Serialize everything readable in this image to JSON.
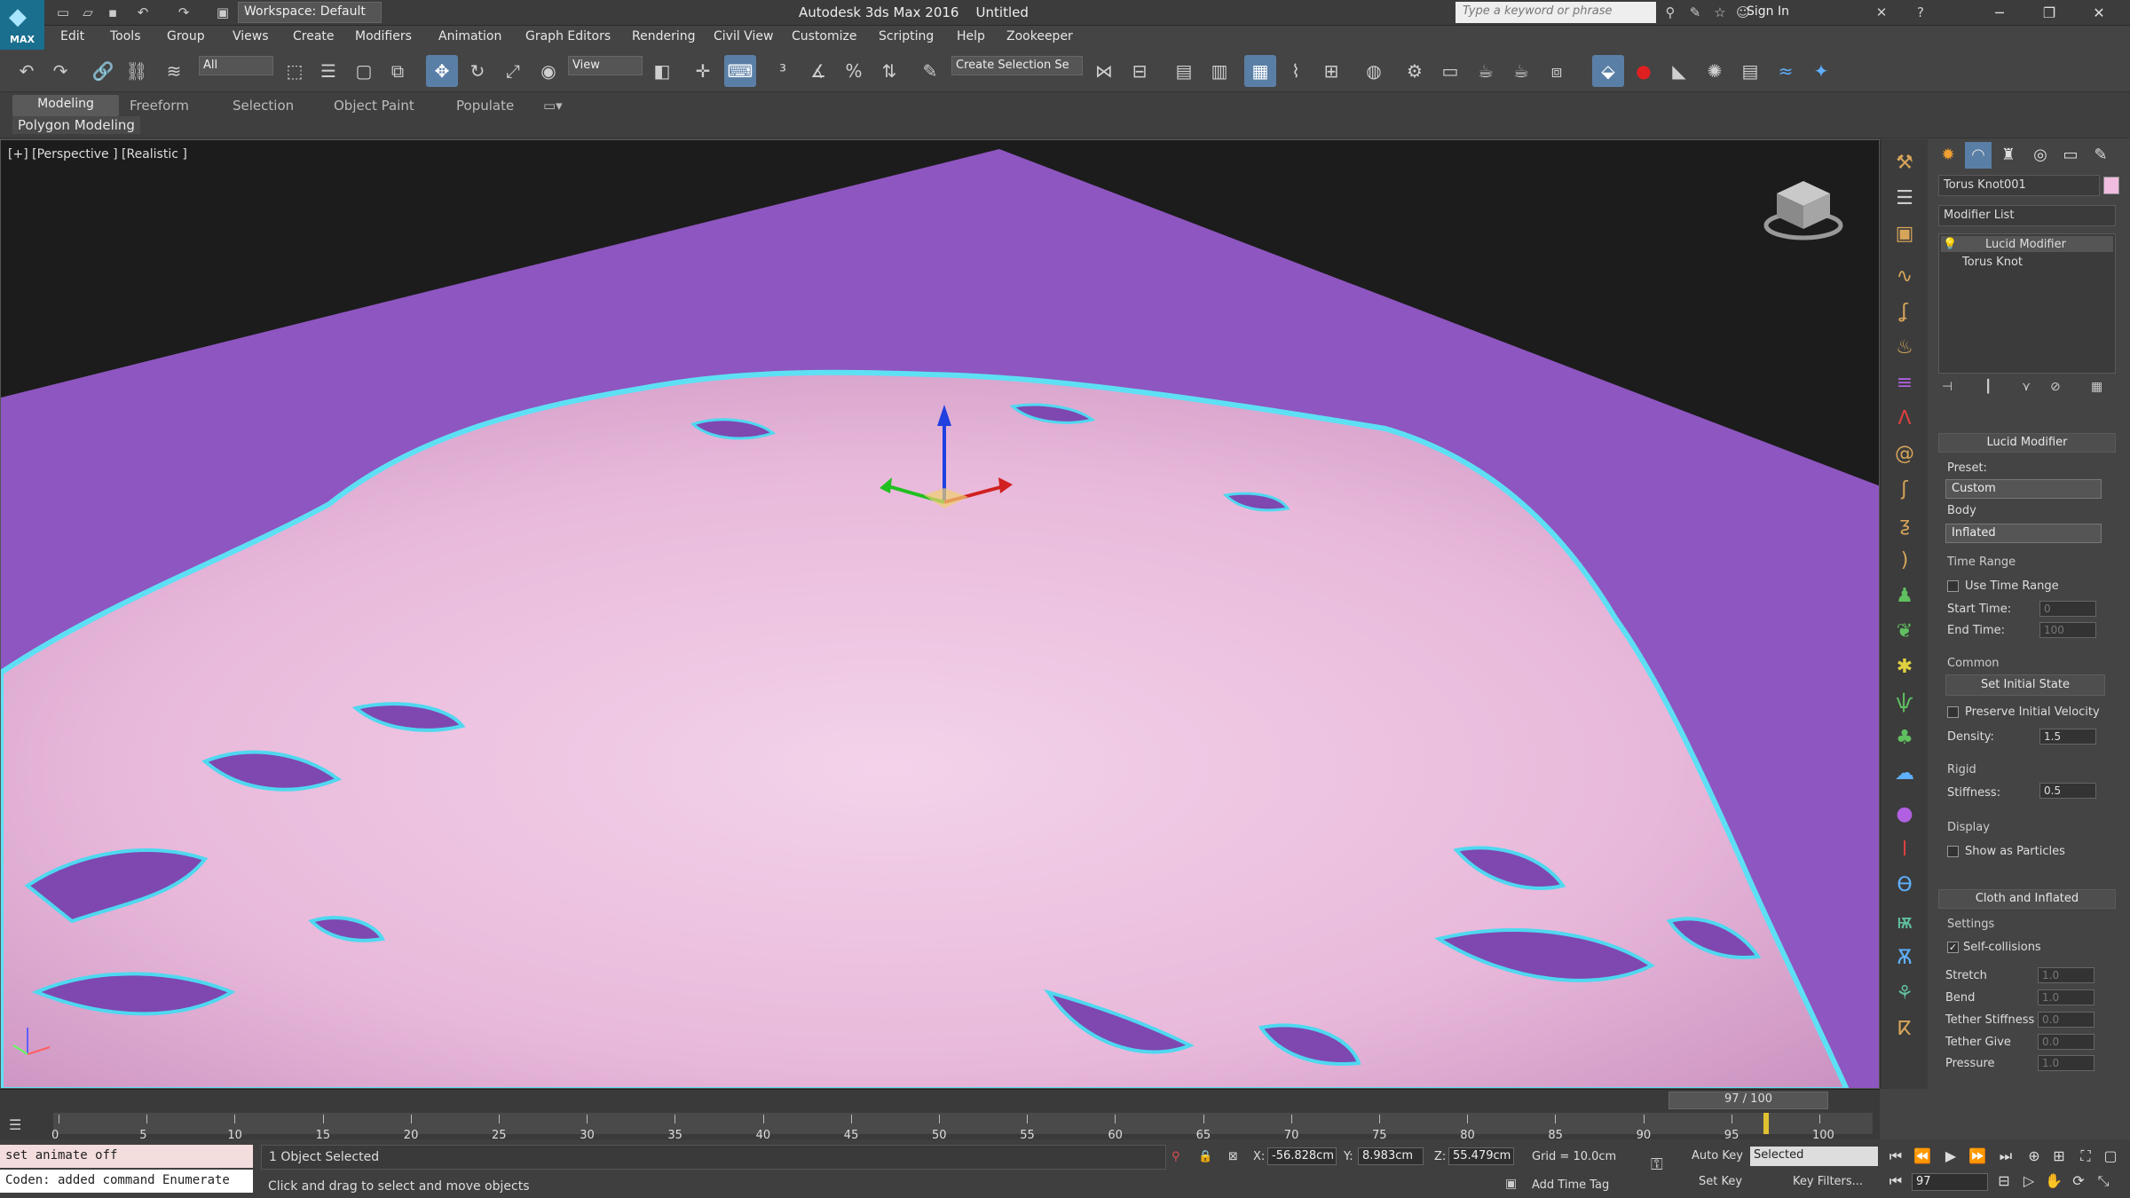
{
  "titlebar": {
    "app_logo_text": "MAX",
    "workspace": "Workspace: Default",
    "title": "Autodesk 3ds Max 2016",
    "document": "Untitled",
    "search_placeholder": "Type a keyword or phrase",
    "signin": "Sign In"
  },
  "menu": [
    "Edit",
    "Tools",
    "Group",
    "Views",
    "Create",
    "Modifiers",
    "Animation",
    "Graph Editors",
    "Rendering",
    "Civil View",
    "Customize",
    "Scripting",
    "Help",
    "Zookeeper"
  ],
  "toolbar": {
    "filter": "All",
    "ref_coord": "View",
    "selection_set": "Create Selection Se"
  },
  "ribbon": {
    "tabs": [
      "Modeling",
      "Freeform",
      "Selection",
      "Object Paint",
      "Populate"
    ],
    "panel_label": "Polygon Modeling"
  },
  "viewport": {
    "label": "[+] [Perspective ] [Realistic ]",
    "colors": {
      "backdrop": "#8e56c0",
      "surface": "#f0c4e4",
      "highlight": "#4fd8f0"
    }
  },
  "panel": {
    "object_name": "Torus Knot001",
    "modifier_list": "Modifier List",
    "stack": [
      "Lucid Modifier",
      "Torus Knot"
    ],
    "rollout_lucid": "Lucid Modifier",
    "preset_label": "Preset:",
    "preset_value": "Custom",
    "body_label": "Body",
    "body_value": "Inflated",
    "time_range_group": "Time Range",
    "use_time_range": "Use Time Range",
    "start_time_label": "Start Time:",
    "start_time": "0",
    "end_time_label": "End Time:",
    "end_time": "100",
    "common_group": "Common",
    "set_initial_state": "Set Initial State",
    "preserve_velocity": "Preserve Initial Velocity",
    "density_label": "Density:",
    "density": "1.5",
    "rigid_group": "Rigid",
    "stiffness_label": "Stiffness:",
    "stiffness": "0.5",
    "display_group": "Display",
    "show_particles": "Show as Particles",
    "rollout_cloth": "Cloth and Inflated",
    "settings_group": "Settings",
    "self_collisions": "Self-collisions",
    "stretch_label": "Stretch",
    "stretch": "1.0",
    "bend_label": "Bend",
    "bend": "1.0",
    "tether_stiffness_label": "Tether Stiffness",
    "tether_stiffness": "0.0",
    "tether_give_label": "Tether Give",
    "tether_give": "0.0",
    "pressure_label": "Pressure",
    "pressure": "1.0"
  },
  "timeline": {
    "frame_display": "97 / 100",
    "ticks": [
      "0",
      "5",
      "10",
      "15",
      "20",
      "25",
      "30",
      "35",
      "40",
      "45",
      "50",
      "55",
      "60",
      "65",
      "70",
      "75",
      "80",
      "85",
      "90",
      "95",
      "100"
    ],
    "current_frame": 97,
    "max_frame": 100
  },
  "status": {
    "script_line1": "set animate off",
    "script_line2": "Coden: added command Enumerate",
    "selection": "1 Object Selected",
    "prompt": "Click and drag to select and move objects",
    "x_label": "X:",
    "x": "-56.828cm",
    "y_label": "Y:",
    "y": "8.983cm",
    "z_label": "Z:",
    "z": "55.479cm",
    "grid": "Grid = 10.0cm",
    "auto_key": "Auto Key",
    "key_mode": "Selected",
    "set_key": "Set Key",
    "key_filters": "Key Filters...",
    "add_time_tag": "Add Time Tag",
    "frame": "97"
  }
}
